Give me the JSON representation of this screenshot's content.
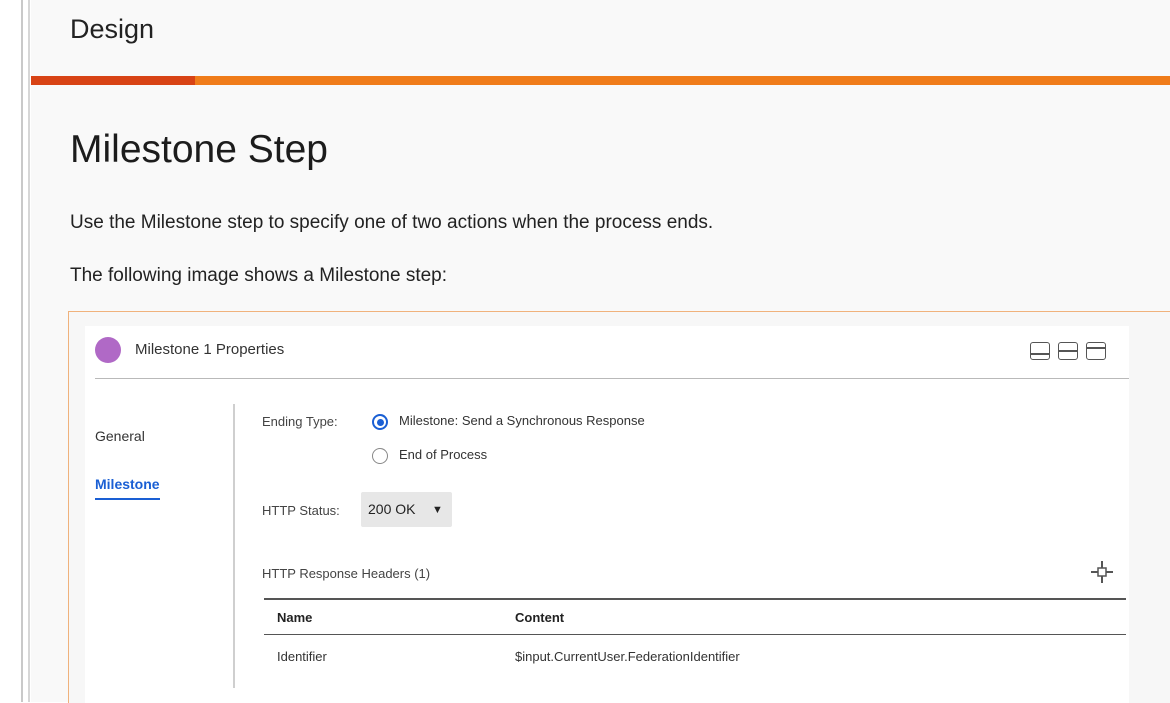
{
  "section": {
    "title": "Design"
  },
  "page": {
    "title": "Milestone Step",
    "paragraph1": "Use the Milestone step to specify one of two actions when the process ends.",
    "paragraph2": "The following image shows a Milestone step:"
  },
  "colors": {
    "accent_orange": "#f07c1a",
    "accent_red": "#d84315",
    "milestone_purple": "#b069c6",
    "active_blue": "#1a5fd4"
  },
  "panel": {
    "title": "Milestone 1 Properties",
    "icon": "circle-icon",
    "layout_icons": [
      "layout-bottom-icon",
      "layout-split-icon",
      "layout-top-icon"
    ],
    "tabs": [
      {
        "label": "General",
        "active": false
      },
      {
        "label": "Milestone",
        "active": true
      }
    ],
    "form": {
      "ending_type_label": "Ending Type:",
      "options": [
        {
          "label": "Milestone: Send a Synchronous Response",
          "selected": true
        },
        {
          "label": "End of Process",
          "selected": false
        }
      ],
      "http_status_label": "HTTP Status:",
      "http_status_value": "200 OK",
      "headers_title": "HTTP Response Headers (1)",
      "add_icon": "plus-icon",
      "table": {
        "columns": [
          "Name",
          "Content"
        ],
        "rows": [
          {
            "name": "Identifier",
            "content": "$input.CurrentUser.FederationIdentifier"
          }
        ]
      }
    }
  }
}
